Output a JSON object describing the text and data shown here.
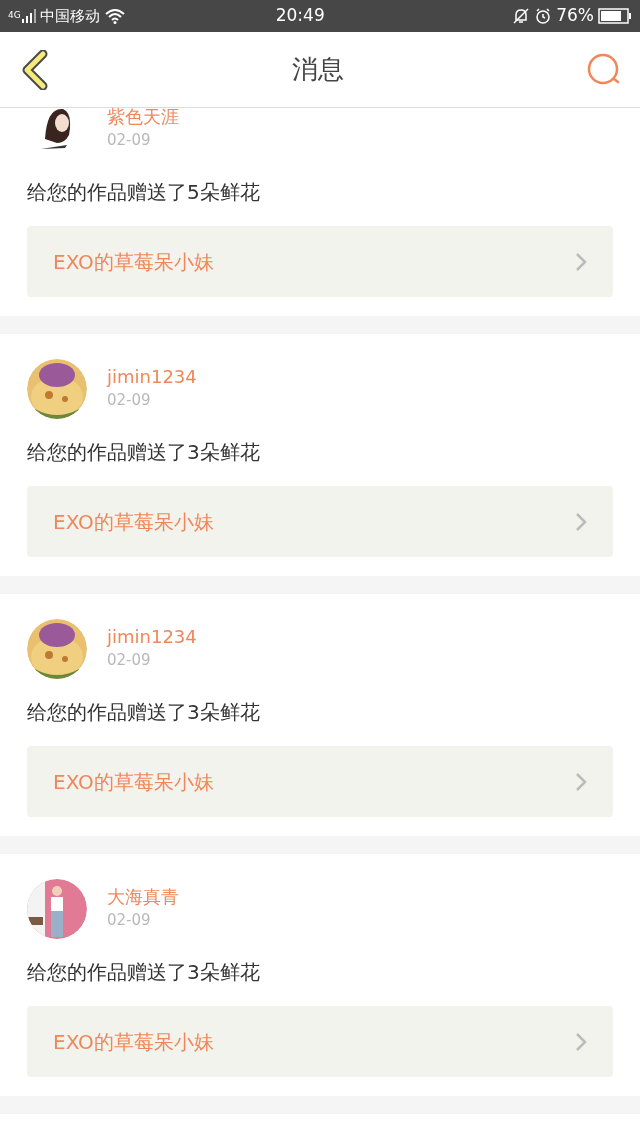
{
  "status_bar": {
    "network": "4G",
    "carrier": "中国移动",
    "time": "20:49",
    "battery": "76%"
  },
  "header": {
    "title": "消息"
  },
  "messages": [
    {
      "user": "紫色天涯",
      "date": "02-09",
      "text": "给您的作品赠送了5朵鲜花",
      "work": "EXO的草莓呆小妹"
    },
    {
      "user": "jimin1234",
      "date": "02-09",
      "text": "给您的作品赠送了3朵鲜花",
      "work": "EXO的草莓呆小妹"
    },
    {
      "user": "jimin1234",
      "date": "02-09",
      "text": "给您的作品赠送了3朵鲜花",
      "work": "EXO的草莓呆小妹"
    },
    {
      "user": "大海真青",
      "date": "02-09",
      "text": "给您的作品赠送了3朵鲜花",
      "work": "EXO的草莓呆小妹"
    }
  ]
}
